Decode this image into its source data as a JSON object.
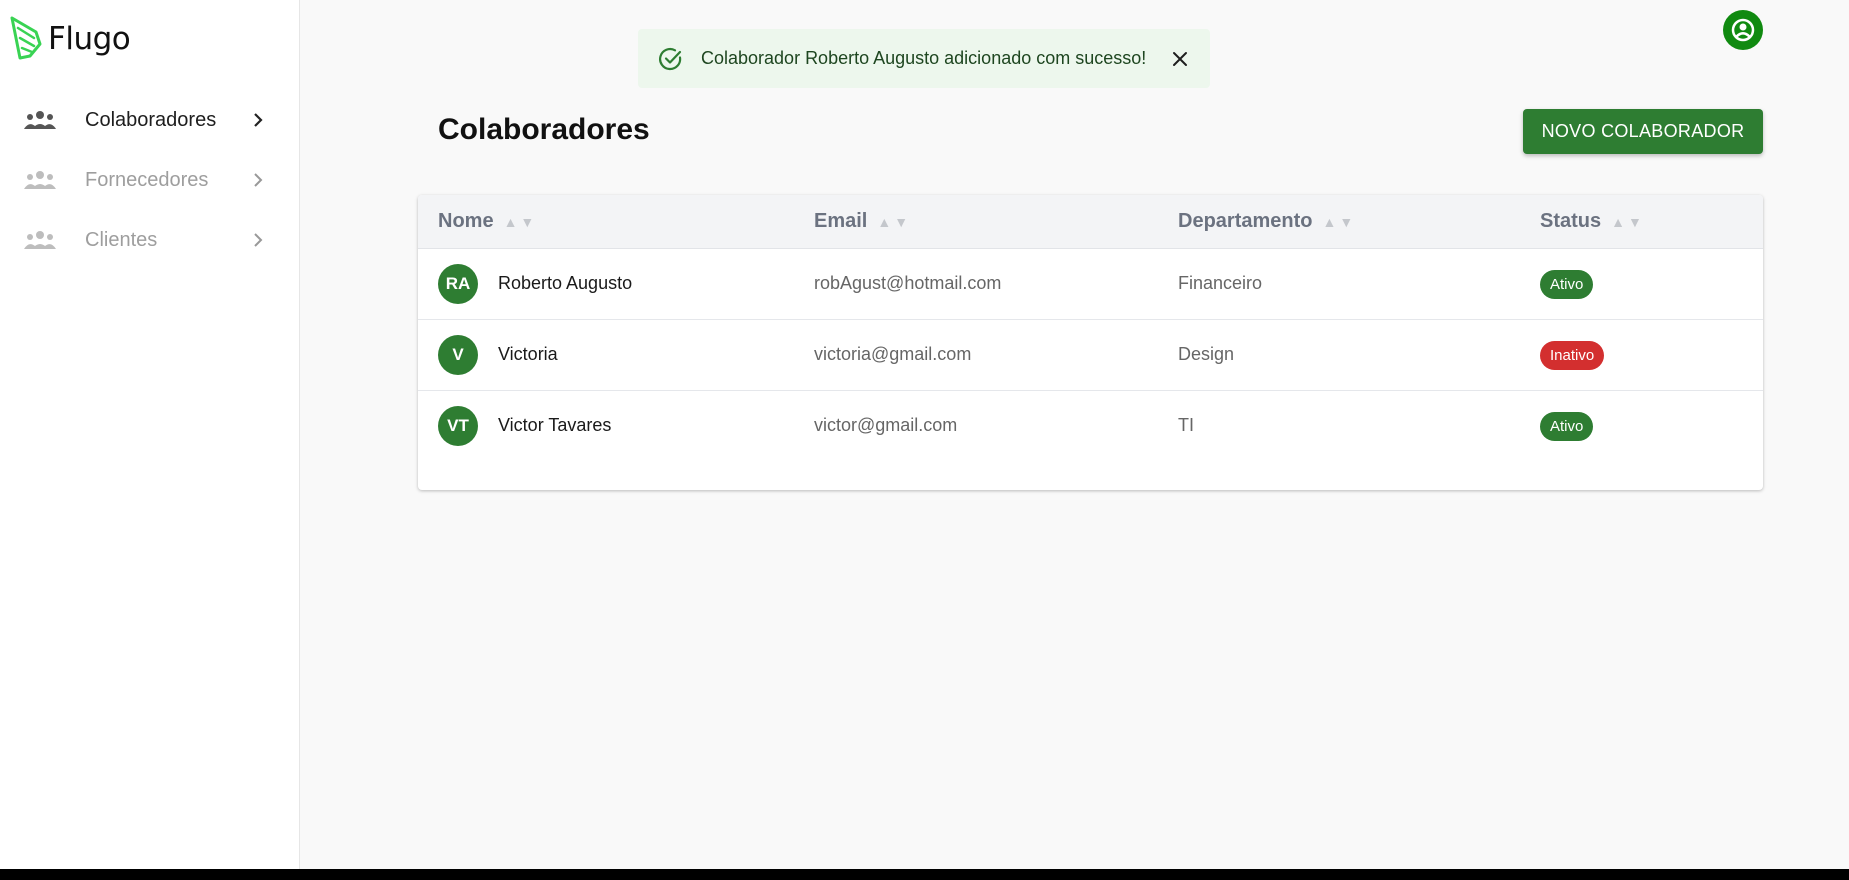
{
  "app": {
    "logo_text": "Flugo",
    "brand_green": "#2e7d32",
    "logo_accent": "#39d353"
  },
  "sidebar": {
    "items": [
      {
        "label": "Colaboradores",
        "icon": "people-icon",
        "active": true
      },
      {
        "label": "Fornecedores",
        "icon": "people-icon",
        "active": false
      },
      {
        "label": "Clientes",
        "icon": "people-icon",
        "active": false
      }
    ]
  },
  "toast": {
    "message": "Colaborador Roberto Augusto adicionado com sucesso!",
    "icon": "check-circle-icon",
    "close_icon": "close-icon",
    "background": "#edf7ed"
  },
  "header": {
    "user_icon": "account-circle-icon"
  },
  "main": {
    "title": "Colaboradores",
    "new_button_label": "NOVO COLABORADOR",
    "sort_glyph": "▲▼",
    "columns": [
      "Nome",
      "Email",
      "Departamento",
      "Status"
    ],
    "rows": [
      {
        "initials": "RA",
        "name": "Roberto Augusto",
        "email": "robAgust@hotmail.com",
        "department": "Financeiro",
        "status": "Ativo"
      },
      {
        "initials": "V",
        "name": "Victoria",
        "email": "victoria@gmail.com",
        "department": "Design",
        "status": "Inativo"
      },
      {
        "initials": "VT",
        "name": "Victor Tavares",
        "email": "victor@gmail.com",
        "department": "TI",
        "status": "Ativo"
      }
    ],
    "status_colors": {
      "Ativo": "#2e7d32",
      "Inativo": "#d32f2f"
    }
  }
}
